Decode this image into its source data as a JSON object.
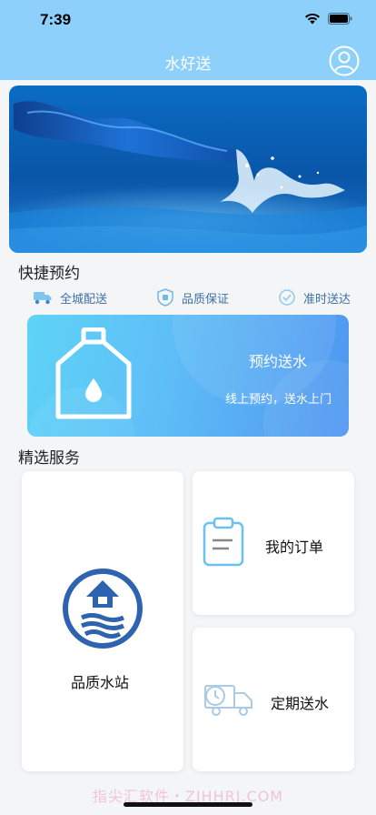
{
  "status_bar": {
    "time": "7:39"
  },
  "nav": {
    "title": "水好送"
  },
  "quick_booking": {
    "title": "快捷预约",
    "features": [
      {
        "label": "全城配送",
        "icon": "truck-icon"
      },
      {
        "label": "品质保证",
        "icon": "quality-shield-icon"
      },
      {
        "label": "准时送达",
        "icon": "on-time-icon"
      }
    ],
    "card": {
      "title": "预约送水",
      "subtitle": "线上预约，送水上门",
      "icon": "water-bottle-icon"
    }
  },
  "featured_services": {
    "title": "精选服务",
    "items": [
      {
        "label": "品质水站",
        "icon": "water-station-icon"
      },
      {
        "label": "我的订单",
        "icon": "clipboard-icon"
      },
      {
        "label": "定期送水",
        "icon": "scheduled-delivery-icon"
      }
    ]
  },
  "watermark": "指尖汇软件・ZJHHRJ.COM",
  "colors": {
    "header": "#8dd0fb",
    "accent": "#2f6db5",
    "booking_card": "#5fc0f7"
  }
}
